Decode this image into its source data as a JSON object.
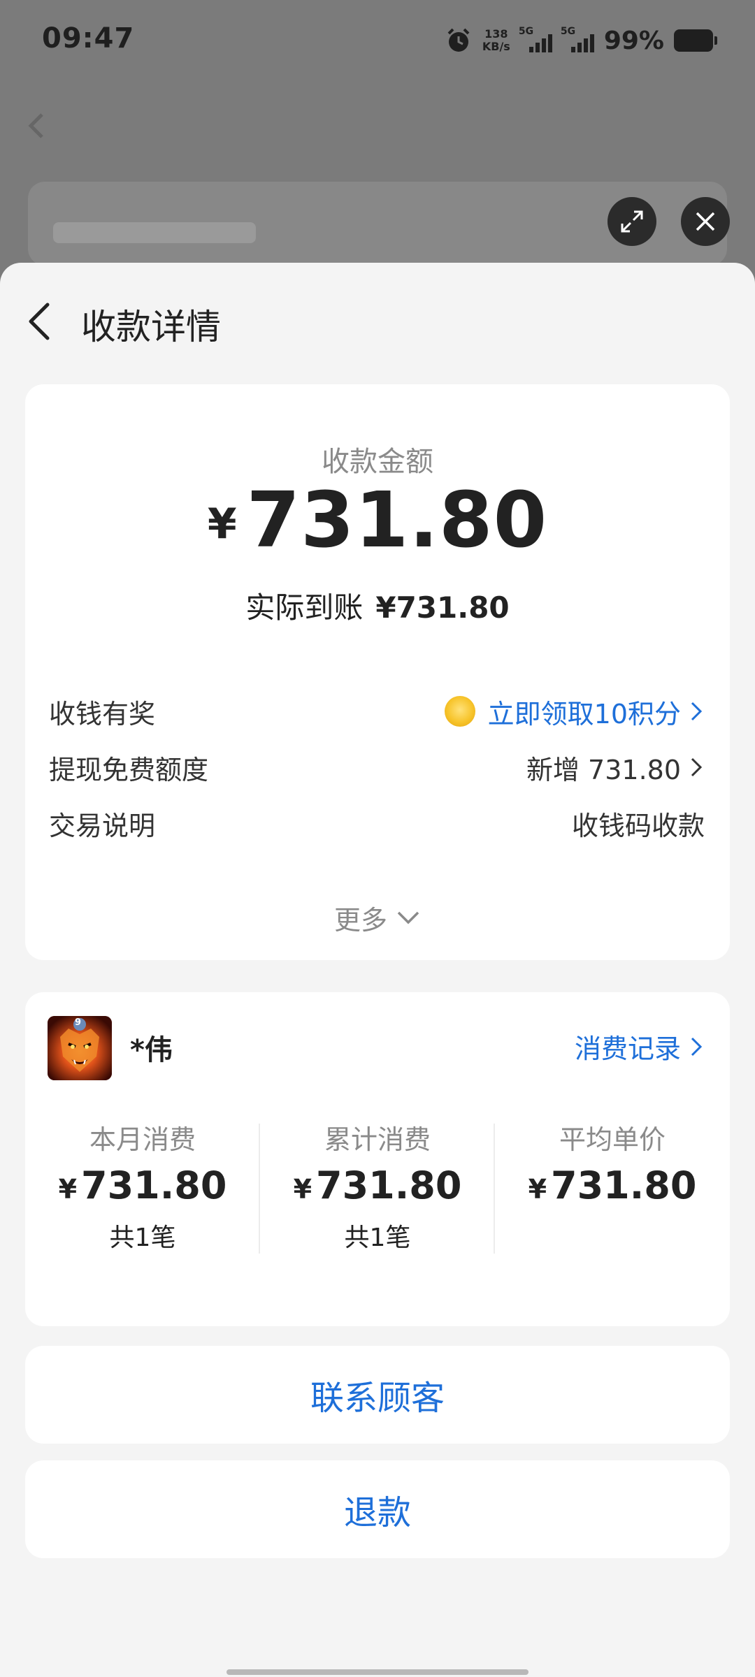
{
  "status_bar": {
    "time": "09:47",
    "net_speed_value": "138",
    "net_speed_unit": "KB/s",
    "sim1_label": "5G",
    "sim2_label": "5G",
    "battery": "99%"
  },
  "sheet": {
    "title": "收款详情"
  },
  "payment": {
    "label": "收款金额",
    "currency": "¥",
    "amount": "731.80",
    "actual_label": "实际到账",
    "actual_value": "¥731.80"
  },
  "details": [
    {
      "label": "收钱有奖",
      "value": "立即领取10积分"
    },
    {
      "label": "提现免费额度",
      "value": "新增 731.80"
    },
    {
      "label": "交易说明",
      "value": "收钱码收款"
    }
  ],
  "more_label": "更多",
  "customer": {
    "name": "*伟",
    "badge": "9",
    "record_link": "消费记录",
    "stats": [
      {
        "label": "本月消费",
        "currency": "¥",
        "value": "731.80",
        "count": "共1笔"
      },
      {
        "label": "累计消费",
        "currency": "¥",
        "value": "731.80",
        "count": "共1笔"
      },
      {
        "label": "平均单价",
        "currency": "¥",
        "value": "731.80",
        "count": ""
      }
    ]
  },
  "actions": {
    "contact": "联系顾客",
    "refund": "退款"
  }
}
